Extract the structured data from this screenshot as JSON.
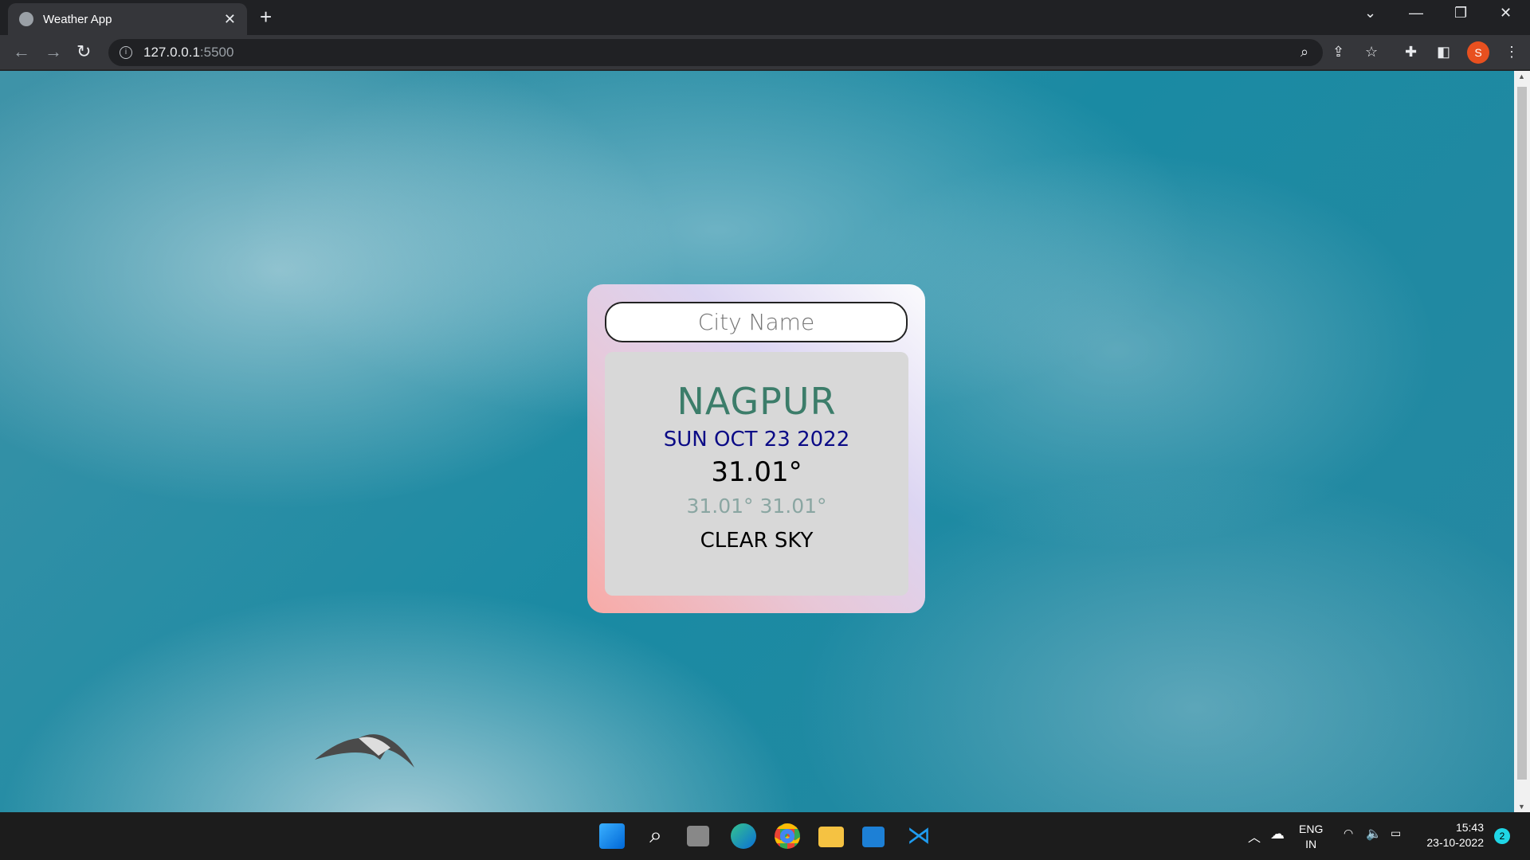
{
  "browser": {
    "tab_title": "Weather App",
    "url_host": "127.0.0.1",
    "url_port": ":5500",
    "profile_initial": "S"
  },
  "weather": {
    "input_placeholder": "City Name",
    "city": "NAGPUR",
    "date": "SUN OCT 23 2022",
    "temp": "31.01°",
    "min_max": "31.01° 31.01°",
    "description": "CLEAR SKY"
  },
  "colors": {
    "city": "#3c7d6a",
    "date": "#0b0b86",
    "minmax": "#8aa6a2"
  },
  "taskbar": {
    "lang_1": "ENG",
    "lang_2": "IN",
    "time": "15:43",
    "date": "23-10-2022",
    "notifications": "2"
  }
}
